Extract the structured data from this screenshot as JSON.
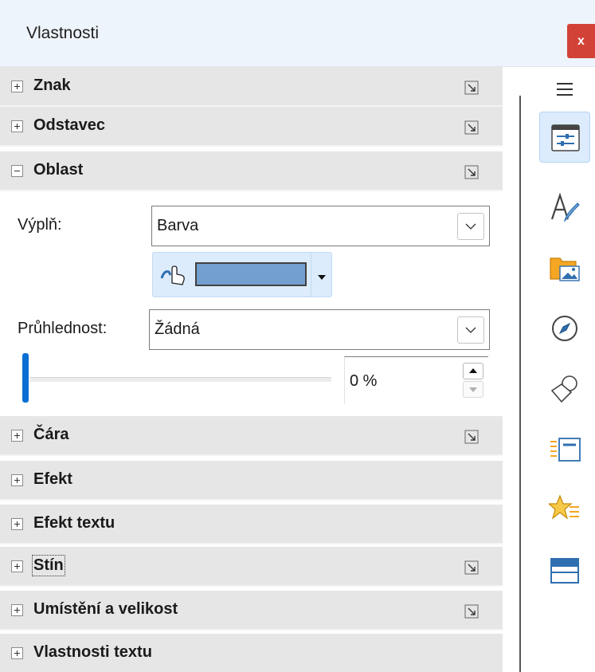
{
  "window": {
    "title": "Vlastnosti",
    "close_label": "x"
  },
  "sections": {
    "znak": {
      "label": "Znak"
    },
    "odstavec": {
      "label": "Odstavec"
    },
    "oblast": {
      "label": "Oblast"
    },
    "cara": {
      "label": "Čára"
    },
    "efekt": {
      "label": "Efekt"
    },
    "efekt_textu": {
      "label": "Efekt textu"
    },
    "stin": {
      "label": "Stín"
    },
    "umisteni": {
      "label": "Umístění a velikost"
    },
    "vlastnosti_textu": {
      "label": "Vlastnosti textu"
    }
  },
  "oblast": {
    "fill_label": "Výplň:",
    "fill_value": "Barva",
    "fill_color": "#729fcf",
    "transparency_label": "Průhlednost:",
    "transparency_value": "Žádná",
    "transparency_slider_percent": 0,
    "transparency_spin_value": "0 %"
  },
  "tabbar": {
    "items": [
      {
        "name": "properties",
        "icon": "sliders-icon",
        "active": true
      },
      {
        "name": "styles",
        "icon": "styles-icon",
        "active": false
      },
      {
        "name": "gallery",
        "icon": "gallery-icon",
        "active": false
      },
      {
        "name": "navigator",
        "icon": "compass-icon",
        "active": false
      },
      {
        "name": "shapes",
        "icon": "shapes-icon",
        "active": false
      },
      {
        "name": "slide-transition",
        "icon": "transition-icon",
        "active": false
      },
      {
        "name": "animation",
        "icon": "star-animation-icon",
        "active": false
      },
      {
        "name": "master-slides",
        "icon": "master-slide-icon",
        "active": false
      }
    ]
  },
  "colors": {
    "accent": "#0a6fd4",
    "close": "#d24236",
    "header_bg": "#e6e6e6",
    "active_tab": "#dcecfc"
  }
}
